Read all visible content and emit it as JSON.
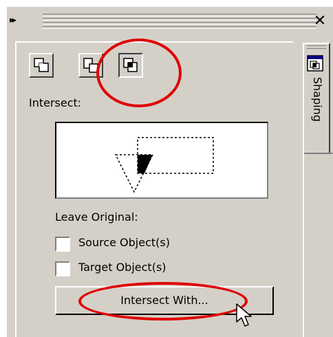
{
  "docker": {
    "expand_icon": "double-chevron-right-icon",
    "close_icon": "close-icon",
    "close_glyph": "✕",
    "tab_label": "Shaping",
    "tab_icon": "shaping-icon"
  },
  "modes": [
    {
      "name": "weld-mode-icon"
    },
    {
      "name": "trim-mode-icon"
    },
    {
      "name": "intersect-mode-icon",
      "selected": true
    }
  ],
  "operation_label": "Intersect:",
  "preview_icon": "intersect-preview",
  "leave_original_label": "Leave Original:",
  "options": [
    {
      "label": "Source Object(s)",
      "checked": false
    },
    {
      "label": "Target Object(s)",
      "checked": false
    }
  ],
  "apply_button_label": "Intersect With...",
  "annotations": {
    "color": "#e00000",
    "cursor": "arrow-cursor-icon"
  },
  "colors": {
    "panel": "#d4d0c8",
    "highlight": "#e00000"
  }
}
